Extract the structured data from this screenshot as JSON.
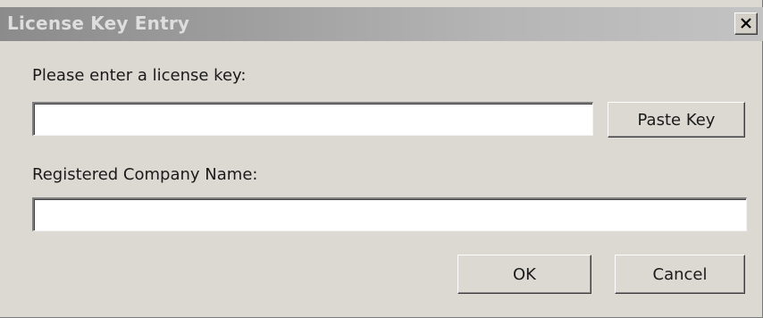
{
  "window": {
    "title": "License Key Entry",
    "close_icon": "close-icon"
  },
  "license_key": {
    "label": "Please enter a license key:",
    "value": "",
    "paste_button": "Paste Key"
  },
  "company": {
    "label": "Registered Company Name:",
    "value": ""
  },
  "actions": {
    "ok": "OK",
    "cancel": "Cancel"
  },
  "colors": {
    "face": "#dcd9d3",
    "titlebar_start": "#8b8b8b",
    "titlebar_end": "#c3c3c3",
    "title_text": "#dedede"
  }
}
